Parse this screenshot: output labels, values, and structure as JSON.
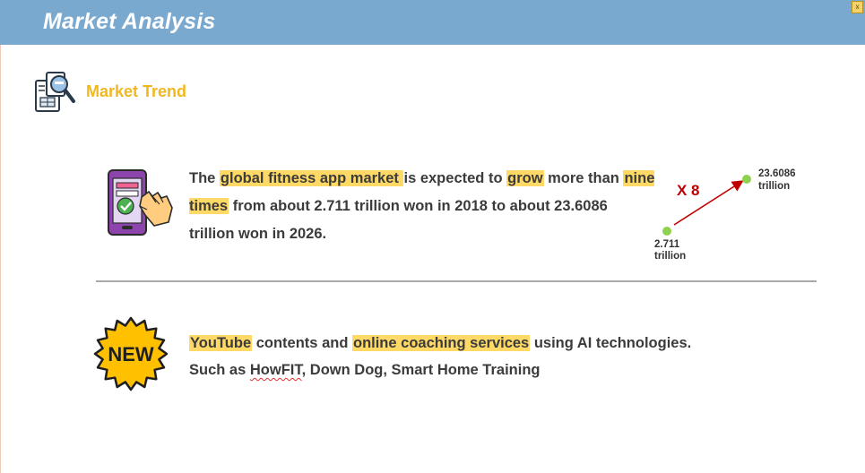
{
  "header": {
    "title": "Market Analysis",
    "close_label": "x"
  },
  "section": {
    "title": "Market Trend",
    "icon": "report-magnifier-icon"
  },
  "trend": {
    "icon": "phone-touch-check-icon",
    "segments": [
      {
        "text": "The ",
        "highlight": false
      },
      {
        "text": "global fitness app market ",
        "highlight": true
      },
      {
        "text": "is expected to ",
        "highlight": false
      },
      {
        "text": "grow",
        "highlight": true
      },
      {
        "text": " more than ",
        "highlight": false
      },
      {
        "text": "nine times",
        "highlight": true
      },
      {
        "text": " from about 2.711 trillion won in 2018 to about 23.6086 trillion won in 2026.",
        "highlight": false
      }
    ]
  },
  "growth": {
    "multiplier_label": "X 8",
    "start_value": "2.711",
    "start_unit": "trillion",
    "end_value": "23.6086",
    "end_unit": "trillion",
    "point_color": "#8fd14f",
    "arrow_color": "#c00000"
  },
  "news": {
    "badge_label": "NEW",
    "badge_color": "#ffc000",
    "line1": [
      {
        "text": "YouTube",
        "highlight": true
      },
      {
        "text": " contents and ",
        "highlight": false
      },
      {
        "text": "online coaching services",
        "highlight": true
      },
      {
        "text": " using AI technologies.",
        "highlight": false
      }
    ],
    "line2_prefix": "Such as ",
    "line2_marked": "HowFIT",
    "line2_rest": ", Down Dog, Smart Home Training"
  },
  "colors": {
    "header_bg": "#7aa9d0",
    "section_title": "#f0b81e",
    "highlight": "#ffd966"
  }
}
